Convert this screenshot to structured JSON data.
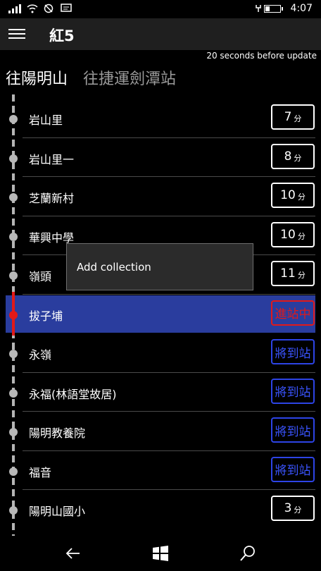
{
  "status": {
    "time": "4:07"
  },
  "app": {
    "title": "紅5",
    "update_note": "20 seconds before update"
  },
  "tabs": [
    {
      "label": "往陽明山"
    },
    {
      "label": "往捷運劍潭站"
    }
  ],
  "stops": [
    {
      "name": "岩山里",
      "eta_num": "7",
      "eta_unit": "分",
      "kind": "time"
    },
    {
      "name": "岩山里一",
      "eta_num": "8",
      "eta_unit": "分",
      "kind": "time"
    },
    {
      "name": "芝蘭新村",
      "eta_num": "10",
      "eta_unit": "分",
      "kind": "time"
    },
    {
      "name": "華興中學",
      "eta_num": "10",
      "eta_unit": "分",
      "kind": "time"
    },
    {
      "name": "嶺頭",
      "eta_num": "11",
      "eta_unit": "分",
      "kind": "time"
    },
    {
      "name": "拔子埔",
      "eta_text": "進站中",
      "kind": "instation"
    },
    {
      "name": "永嶺",
      "eta_text": "將到站",
      "kind": "arriving"
    },
    {
      "name": "永福(林語堂故居)",
      "eta_text": "將到站",
      "kind": "arriving"
    },
    {
      "name": "陽明教養院",
      "eta_text": "將到站",
      "kind": "arriving"
    },
    {
      "name": "福音",
      "eta_text": "將到站",
      "kind": "arriving"
    },
    {
      "name": "陽明山國小",
      "eta_num": "3",
      "eta_unit": "分",
      "kind": "time"
    }
  ],
  "context_menu": {
    "item_label": "Add collection"
  },
  "colors": {
    "highlight": "#2a3d9e",
    "in_station": "#e21919",
    "arriving": "#2d44e6"
  },
  "icons": {
    "menu": "hamburger-icon",
    "back": "back-arrow-icon",
    "home": "windows-icon",
    "search": "search-icon"
  }
}
